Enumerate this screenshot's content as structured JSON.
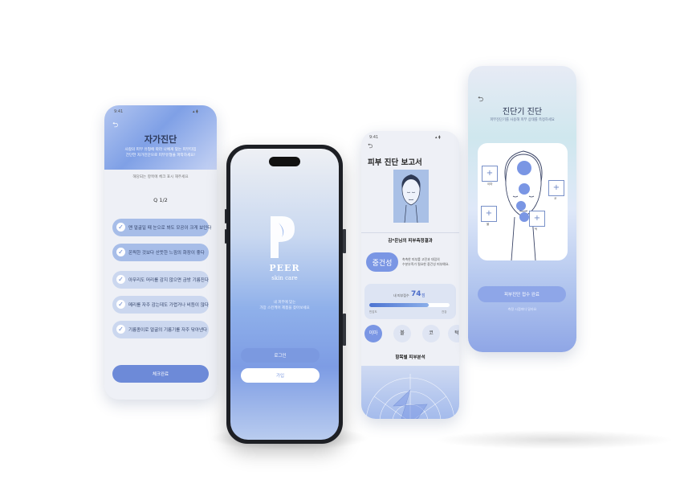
{
  "colors": {
    "accent": "#7fa0e6",
    "brand_dark": "#5b7ccc",
    "device": "#1d1f24"
  },
  "status": {
    "time": "9:41",
    "icons": "▴ ⧫"
  },
  "self_check": {
    "title": "자가진단",
    "subtitle_lines": [
      "사람의 피부 유형에 따라 나에게 맞는 피부타입",
      "간단한 자가진단으로 피부유형을 파악하세요!"
    ],
    "hint": "해당되는 항목에 체크 표시 해주세요",
    "question": "Q  1/2",
    "items": [
      {
        "label": "맨 얼굴일 때 눈으로 봐도 모공이 크게 보인다",
        "checked": true
      },
      {
        "label": "온찍한 것보다 산뜻한 느낌의 화장이 좋다",
        "checked": true
      },
      {
        "label": "아무리도 머리를 감지 않으면 금방 기름진다",
        "checked": true
      },
      {
        "label": "메리를 자주 감는데도 가렵거나 비듬이 많다",
        "checked": true
      },
      {
        "label": "기름종이로 얼굴의 기름기를 자주 닦아낸다",
        "checked": true
      }
    ],
    "submit": "체크완료",
    "back": "⮌"
  },
  "splash": {
    "logo_letter": "P",
    "brand": "PEER",
    "tagline": "skin care",
    "desc_lines": [
      "내 피부에 맞는",
      "가장 스킨케어 제품을 찾아보세요"
    ],
    "login": "로그인",
    "signup": "가입"
  },
  "report": {
    "title": "피부 진단 보고서",
    "result_heading": "김*은님의 피부측정결과",
    "type_badge": "중건성",
    "type_desc": [
      "촉촉한 피부를 고민과 대립의",
      "수분부족가 필요한 중건성 피부예요."
    ],
    "score_label": "내 피부점수",
    "score": "74",
    "score_unit": "점",
    "score_fraction": 0.74,
    "scale_min": "민감도",
    "scale_max": "건강",
    "tabs": [
      "이마",
      "볼",
      "코",
      "턱"
    ],
    "section": "항목별 피부분석",
    "back": "⮌"
  },
  "diagnosis": {
    "title": "진단기 진단",
    "subtitle": "피부진단기를 사용해 피부 상태를 측정하세요",
    "zones": [
      "이마",
      "코",
      "볼",
      "턱"
    ],
    "complete": "피부진단 접수 완료",
    "note": "측정 시점마다 달라요",
    "back": "⮌"
  }
}
